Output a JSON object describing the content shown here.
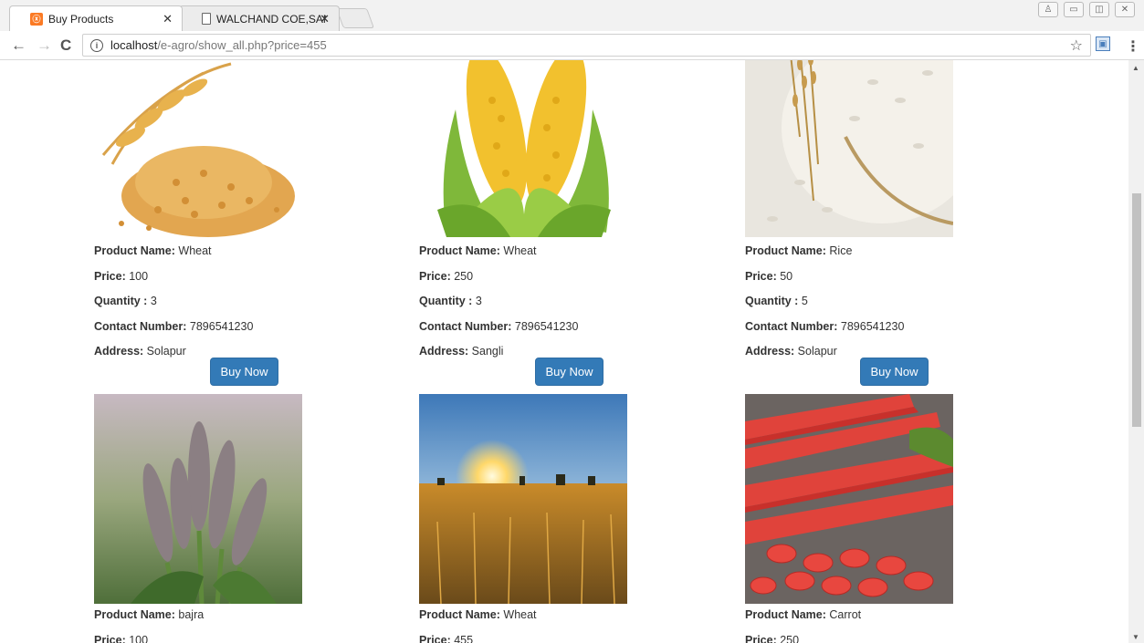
{
  "browser": {
    "tabs": [
      {
        "title": "Buy Products",
        "favicon": "xampp-icon",
        "active": true
      },
      {
        "title": "WALCHAND COE,SANGL",
        "favicon": "document-icon",
        "active": false
      }
    ],
    "url_host": "localhost",
    "url_path": "/e-agro/show_all.php?price=455"
  },
  "labels": {
    "product_name": "Product Name:",
    "price": "Price:",
    "quantity": "Quantity :",
    "contact": "Contact Number:",
    "address": "Address:",
    "buy_now": "Buy Now"
  },
  "products": [
    {
      "name": "Wheat",
      "price": "100",
      "quantity": "3",
      "contact": "7896541230",
      "address": "Solapur",
      "image": "wheat-grain-image"
    },
    {
      "name": "Wheat",
      "price": "250",
      "quantity": "3",
      "contact": "7896541230",
      "address": "Sangli",
      "image": "corn-image"
    },
    {
      "name": "Rice",
      "price": "50",
      "quantity": "5",
      "contact": "7896541230",
      "address": "Solapur",
      "image": "rice-image"
    },
    {
      "name": "bajra",
      "price": "100",
      "image": "bajra-image"
    },
    {
      "name": "Wheat",
      "price": "455",
      "image": "wheat-field-sunset-image"
    },
    {
      "name": "Carrot",
      "price": "250",
      "image": "carrot-image"
    }
  ],
  "colors": {
    "button_bg": "#337ab7",
    "button_text": "#ffffff",
    "text": "#333333"
  }
}
